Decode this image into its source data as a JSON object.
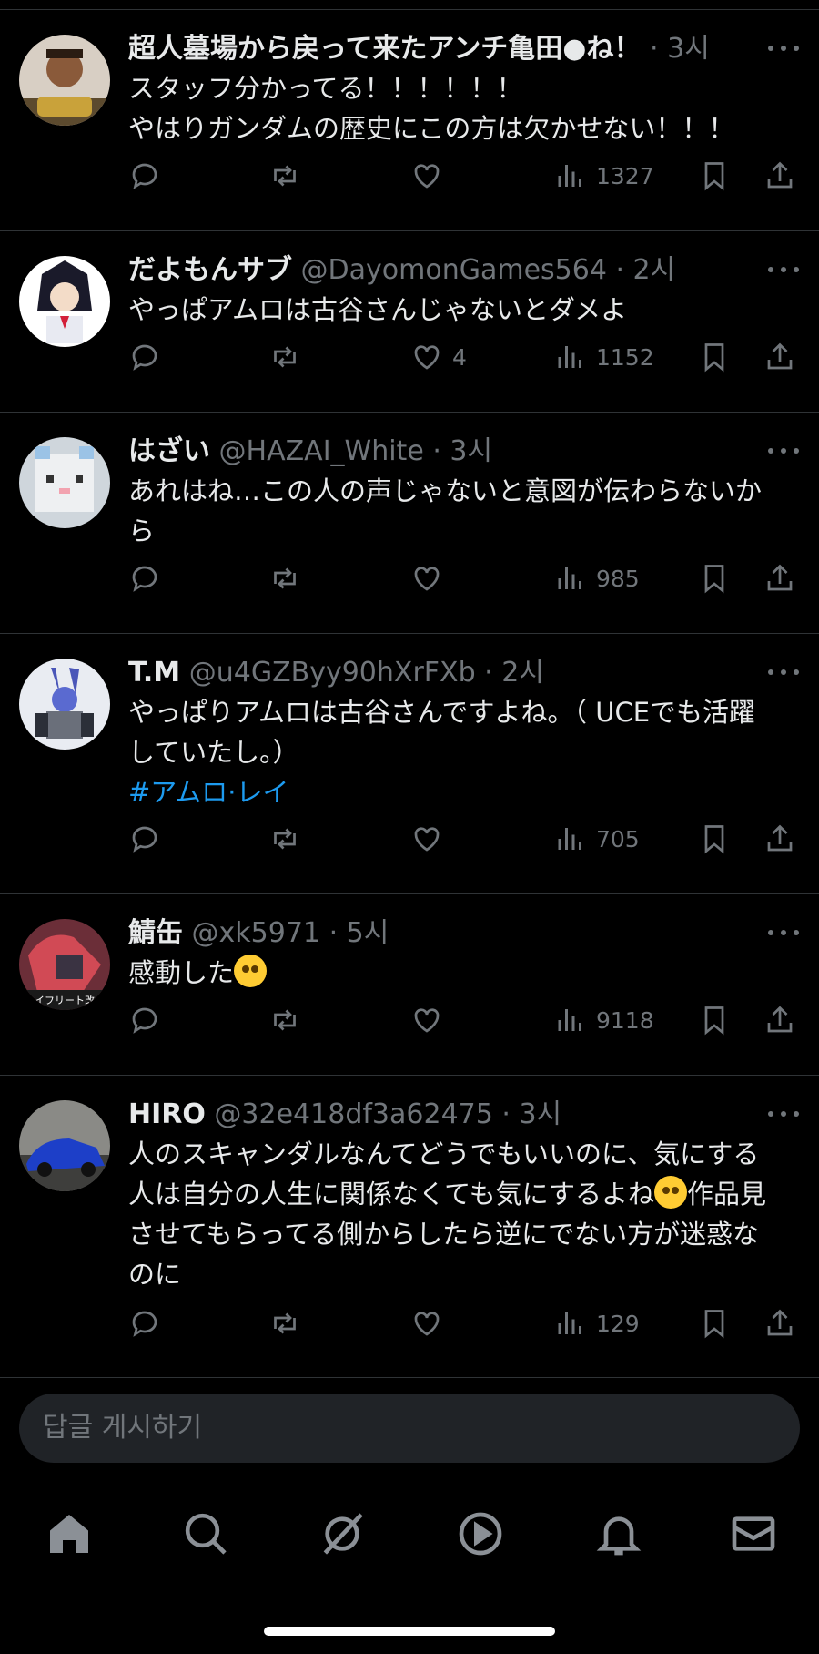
{
  "tweets": [
    {
      "name": "超人墓場から戻って来たアンチ亀田●ね！",
      "handle": "",
      "time": "3시",
      "lines": [
        "スタッフ分かってる！！！！！！",
        "やはりガンダムの歴史にこの方は欠かせない！！！"
      ],
      "likes": "",
      "views": "1327"
    },
    {
      "name": "だよもんサブ",
      "handle": "@DayomonGames564",
      "time": "2시",
      "lines": [
        "やっぱアムロは古谷さんじゃないとダメよ"
      ],
      "likes": "4",
      "views": "1152"
    },
    {
      "name": "はざい",
      "handle": "@HAZAI_White",
      "time": "3시",
      "lines": [
        "あれはね…この人の声じゃないと意図が伝わらないか",
        "ら"
      ],
      "likes": "",
      "views": "985"
    },
    {
      "name": "T.M",
      "handle": "@u4GZByy90hXrFXb",
      "time": "2시",
      "lines": [
        "やっぱりアムロは古谷さんですよね。（ UCEでも活躍",
        "していたし。）"
      ],
      "hashtag": "#アムロ·レイ",
      "likes": "",
      "views": "705"
    },
    {
      "name": "鯖缶",
      "handle": "@xk5971",
      "time": "5시",
      "lines": [
        "感動した"
      ],
      "likes": "",
      "views": "9118"
    },
    {
      "name": "HIRO",
      "handle": "@32e418df3a62475",
      "time": "3시",
      "lines": [
        "人のスキャンダルなんてどうでもいいのに、気にする",
        "人は自分の人生に関係なくても気にするよね",
        "させてもらってる側からしたら逆にでない方が迷惑な",
        "のに"
      ],
      "line2_suffix": "作品見",
      "likes": "",
      "views": "129"
    }
  ],
  "reply_placeholder": "답글 게시하기",
  "nav": [
    "home-icon",
    "search-icon",
    "grok-icon",
    "video-icon",
    "notifications-icon",
    "messages-icon"
  ],
  "colors": {
    "background": "#000000",
    "text": "#e7e9ea",
    "muted": "#71767b",
    "link": "#1d9bf0",
    "divider": "#2f3336"
  }
}
